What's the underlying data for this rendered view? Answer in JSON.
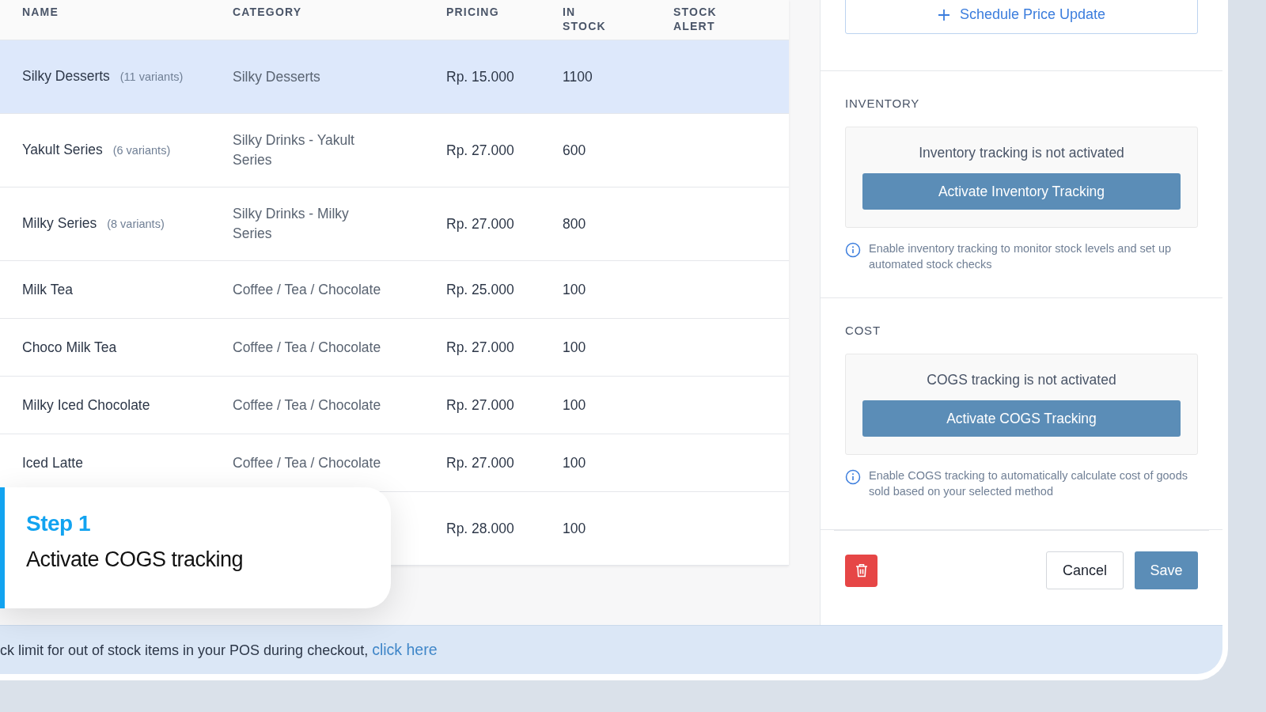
{
  "table": {
    "columns": [
      "NAME",
      "CATEGORY",
      "PRICING",
      "IN STOCK",
      "STOCK ALERT"
    ],
    "rows": [
      {
        "name": "Silky Desserts",
        "variants": "(11 variants)",
        "category": "Silky Desserts",
        "pricing": "Rp. 15.000",
        "in_stock": "1100",
        "selected": true
      },
      {
        "name": "Yakult Series",
        "variants": "(6 variants)",
        "category": "Silky Drinks - Yakult Series",
        "pricing": "Rp. 27.000",
        "in_stock": "600",
        "selected": false
      },
      {
        "name": "Milky Series",
        "variants": "(8 variants)",
        "category": "Silky Drinks - Milky Series",
        "pricing": "Rp. 27.000",
        "in_stock": "800",
        "selected": false
      },
      {
        "name": "Milk Tea",
        "category": "Coffee / Tea / Chocolate",
        "pricing": "Rp. 25.000",
        "in_stock": "100",
        "selected": false
      },
      {
        "name": "Choco Milk Tea",
        "category": "Coffee / Tea / Chocolate",
        "pricing": "Rp. 27.000",
        "in_stock": "100",
        "selected": false
      },
      {
        "name": "Milky Iced Chocolate",
        "category": "Coffee / Tea / Chocolate",
        "pricing": "Rp. 27.000",
        "in_stock": "100",
        "selected": false
      },
      {
        "name": "Iced Latte",
        "category": "Coffee / Tea / Chocolate",
        "pricing": "Rp. 27.000",
        "in_stock": "100",
        "selected": false
      },
      {
        "pricing": "Rp. 28.000",
        "in_stock": "100",
        "selected": false
      }
    ]
  },
  "step_card": {
    "step": "Step 1",
    "text": "Activate COGS tracking"
  },
  "side_panel": {
    "schedule_button": "Schedule Price Update",
    "sections": [
      {
        "title": "INVENTORY",
        "status": "Inventory tracking is not activated",
        "button": "Activate Inventory Tracking",
        "info": "Enable inventory tracking to monitor stock levels and set up automated stock checks"
      },
      {
        "title": "COST",
        "status": "COGS tracking is not activated",
        "button": "Activate COGS Tracking",
        "info": "Enable COGS tracking to automatically calculate cost of goods sold based on your selected method"
      }
    ],
    "cancel": "Cancel",
    "save": "Save"
  },
  "banner": {
    "text": "ck limit for out of stock items in your POS during checkout,",
    "link": "click here"
  }
}
